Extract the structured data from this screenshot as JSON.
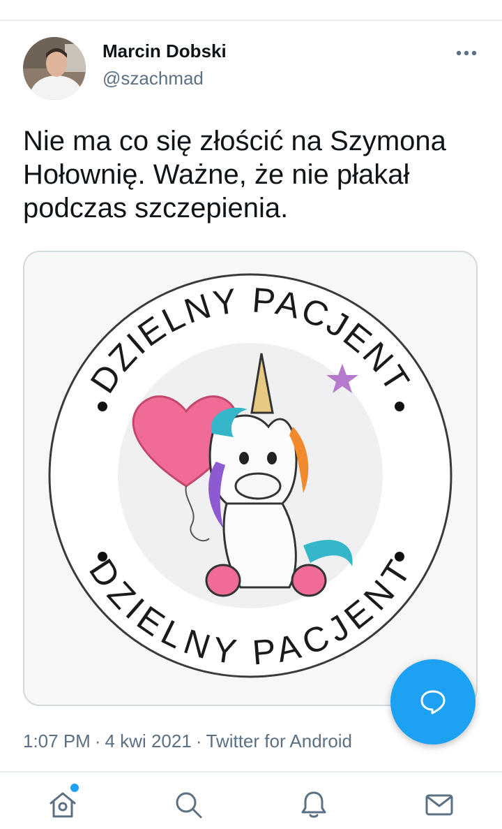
{
  "tweet": {
    "author_name": "Marcin Dobski",
    "author_handle": "@szachmad",
    "text": "Nie ma co się złościć na Szymona Hołownię. Ważne, że nie płakał podczas szczepienia.",
    "time": "1:07 PM",
    "date": "4 kwi 2021",
    "source": "Twitter for Android",
    "separator": "·"
  },
  "media": {
    "badge_top_text": "DZIELNY PACJENT",
    "badge_bottom_text": "DZIELNY PACJENT",
    "icon": "unicorn-illustration"
  },
  "actions": {
    "more_icon": "more-horizontal-icon",
    "compose_icon": "speech-bubble-icon"
  },
  "bottom_nav": {
    "items": [
      {
        "id": "home",
        "icon": "home-icon",
        "has_dot": true
      },
      {
        "id": "search",
        "icon": "search-icon"
      },
      {
        "id": "notifications",
        "icon": "bell-icon"
      },
      {
        "id": "messages",
        "icon": "mail-icon"
      }
    ]
  },
  "colors": {
    "accent": "#1da1f2",
    "text_primary": "#0f1419",
    "text_secondary": "#5b7083",
    "divider": "#e6ecf0"
  }
}
